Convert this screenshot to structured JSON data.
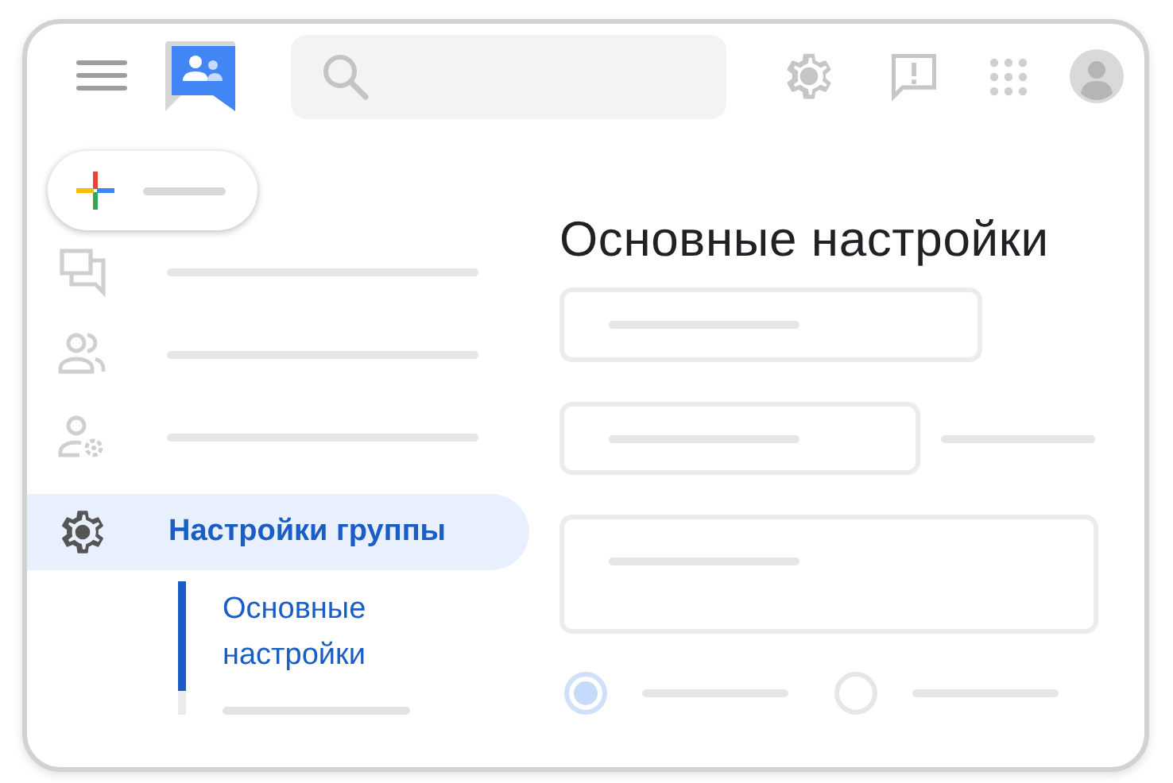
{
  "page_title": "Основные настройки",
  "nav": [
    {
      "selected": false
    },
    {
      "selected": false
    },
    {
      "selected": false
    },
    {
      "label": "Настройки группы",
      "selected": true
    }
  ],
  "subnav": [
    {
      "label": "Основные настройки",
      "selected": true
    },
    {
      "selected": false
    }
  ],
  "radios": [
    {
      "selected": true
    },
    {
      "selected": false
    }
  ]
}
